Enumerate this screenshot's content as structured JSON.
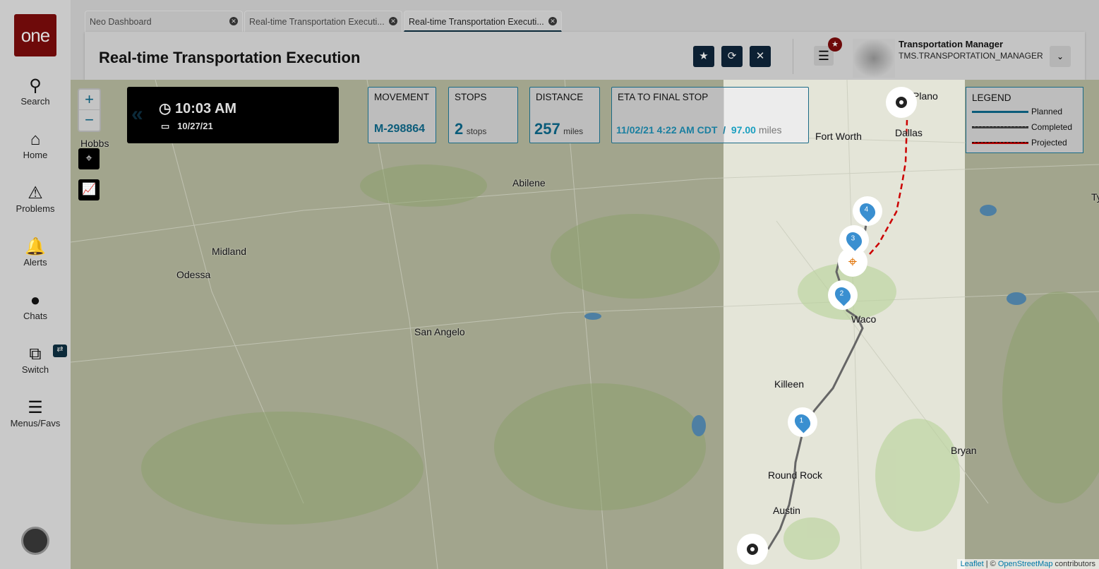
{
  "sidebar": {
    "logo": "one",
    "items": [
      {
        "label": "Search",
        "icon": "search-icon"
      },
      {
        "label": "Home",
        "icon": "home-icon"
      },
      {
        "label": "Problems",
        "icon": "warning-icon"
      },
      {
        "label": "Alerts",
        "icon": "bell-icon"
      },
      {
        "label": "Chats",
        "icon": "chat-icon"
      },
      {
        "label": "Switch",
        "icon": "switch-icon"
      },
      {
        "label": "Menus/Favs",
        "icon": "menu-icon"
      }
    ]
  },
  "tabs": [
    {
      "label": "Neo Dashboard"
    },
    {
      "label": "Real-time Transportation Executi..."
    },
    {
      "label": "Real-time Transportation Executi..."
    }
  ],
  "header": {
    "title": "Real-time Transportation Execution",
    "user_name": "Transportation Manager",
    "user_role": "TMS.TRANSPORTATION_MANAGER"
  },
  "time_panel": {
    "time": "10:03 AM",
    "date": "10/27/21"
  },
  "cards": {
    "movement_label": "MOVEMENT",
    "movement": "M-298864",
    "stops_label": "STOPS",
    "stops": "2",
    "stops_unit": "stops",
    "distance_label": "DISTANCE",
    "distance": "257",
    "distance_unit": "miles",
    "eta_label": "ETA TO FINAL STOP",
    "eta": "11/02/21 4:22 AM CDT",
    "eta_sep": "/",
    "eta_miles": "97.00",
    "eta_unit": "miles"
  },
  "legend": {
    "title": "LEGEND",
    "planned": "Planned",
    "completed": "Completed",
    "projected": "Projected",
    "colors": {
      "planned": "#0b5c7a",
      "completed": "#333333",
      "projected": "#b00000"
    }
  },
  "map": {
    "zoom_in": "+",
    "zoom_out": "−",
    "cities": [
      "Hobbs",
      "Abilene",
      "Midland",
      "Odessa",
      "San Angelo",
      "Fort Worth",
      "Dallas",
      "Plano",
      "Waco",
      "Killeen",
      "Round Rock",
      "Austin",
      "Bryan",
      "Ty"
    ],
    "stops": [
      "1",
      "2",
      "3",
      "4"
    ],
    "attribution_leaflet": "Leaflet",
    "attribution_sep": " | © ",
    "attribution_osm": "OpenStreetMap",
    "attribution_suffix": " contributors"
  }
}
